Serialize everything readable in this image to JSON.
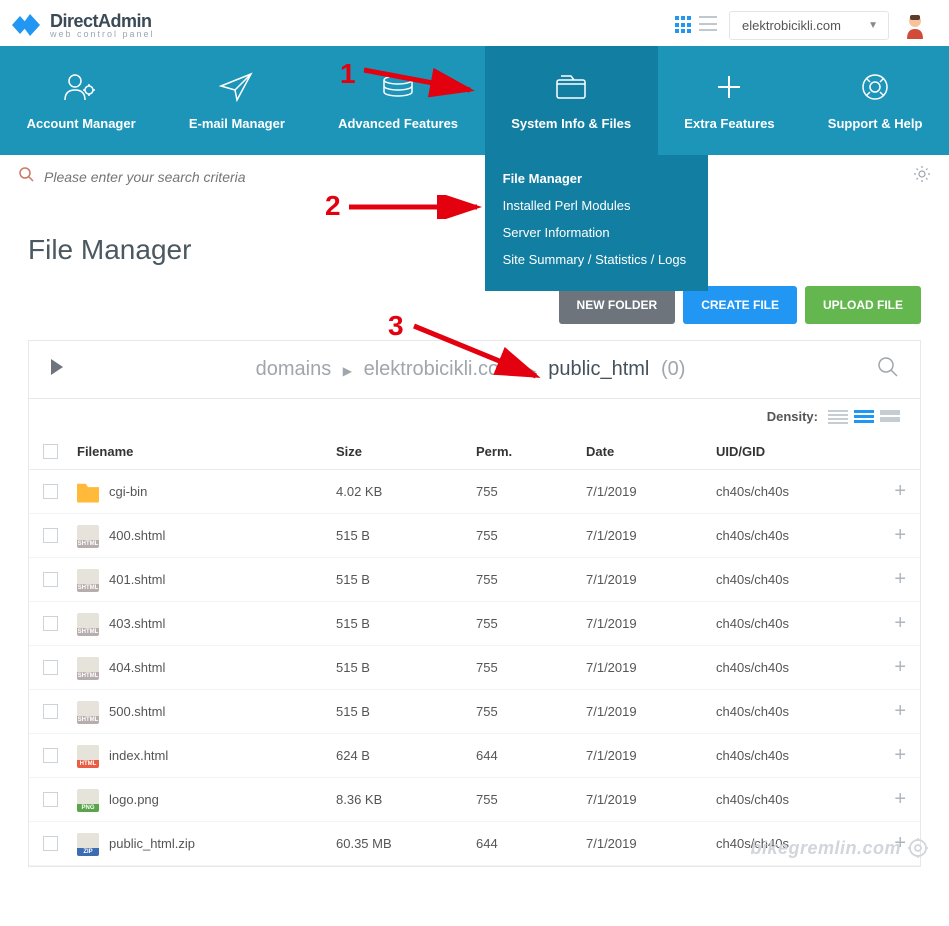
{
  "logo": {
    "title": "DirectAdmin",
    "subtitle": "web control panel"
  },
  "domain_selector": "elektrobicikli.com",
  "nav": [
    {
      "label": "Account Manager"
    },
    {
      "label": "E-mail Manager"
    },
    {
      "label": "Advanced Features"
    },
    {
      "label": "System Info & Files",
      "active": true
    },
    {
      "label": "Extra Features"
    },
    {
      "label": "Support & Help"
    }
  ],
  "dropdown": [
    {
      "label": "File Manager",
      "bold": true
    },
    {
      "label": "Installed Perl Modules"
    },
    {
      "label": "Server Information"
    },
    {
      "label": "Site Summary / Statistics / Logs"
    }
  ],
  "search_placeholder": "Please enter your search criteria",
  "page_title": "File Manager",
  "actions": {
    "new_folder": "NEW FOLDER",
    "create_file": "CREATE FILE",
    "upload_file": "UPLOAD FILE"
  },
  "breadcrumbs": {
    "parts": [
      "domains",
      "elektrobicikli.com",
      "public_html"
    ],
    "count": "(0)"
  },
  "density_label": "Density:",
  "columns": {
    "name": "Filename",
    "size": "Size",
    "perm": "Perm.",
    "date": "Date",
    "uid": "UID/GID"
  },
  "rows": [
    {
      "name": "cgi-bin",
      "type": "folder",
      "ext": "",
      "size": "4.02 KB",
      "perm": "755",
      "date": "7/1/2019",
      "uid": "ch40s/ch40s"
    },
    {
      "name": "400.shtml",
      "type": "file",
      "ext": "shtml",
      "size": "515 B",
      "perm": "755",
      "date": "7/1/2019",
      "uid": "ch40s/ch40s"
    },
    {
      "name": "401.shtml",
      "type": "file",
      "ext": "shtml",
      "size": "515 B",
      "perm": "755",
      "date": "7/1/2019",
      "uid": "ch40s/ch40s"
    },
    {
      "name": "403.shtml",
      "type": "file",
      "ext": "shtml",
      "size": "515 B",
      "perm": "755",
      "date": "7/1/2019",
      "uid": "ch40s/ch40s"
    },
    {
      "name": "404.shtml",
      "type": "file",
      "ext": "shtml",
      "size": "515 B",
      "perm": "755",
      "date": "7/1/2019",
      "uid": "ch40s/ch40s"
    },
    {
      "name": "500.shtml",
      "type": "file",
      "ext": "shtml",
      "size": "515 B",
      "perm": "755",
      "date": "7/1/2019",
      "uid": "ch40s/ch40s"
    },
    {
      "name": "index.html",
      "type": "file",
      "ext": "html",
      "size": "624 B",
      "perm": "644",
      "date": "7/1/2019",
      "uid": "ch40s/ch40s"
    },
    {
      "name": "logo.png",
      "type": "file",
      "ext": "png",
      "size": "8.36 KB",
      "perm": "755",
      "date": "7/1/2019",
      "uid": "ch40s/ch40s"
    },
    {
      "name": "public_html.zip",
      "type": "file",
      "ext": "zip",
      "size": "60.35 MB",
      "perm": "644",
      "date": "7/1/2019",
      "uid": "ch40s/ch40s"
    }
  ],
  "annotations": {
    "n1": "1",
    "n2": "2",
    "n3": "3"
  },
  "watermark": "bikegremlin.com"
}
